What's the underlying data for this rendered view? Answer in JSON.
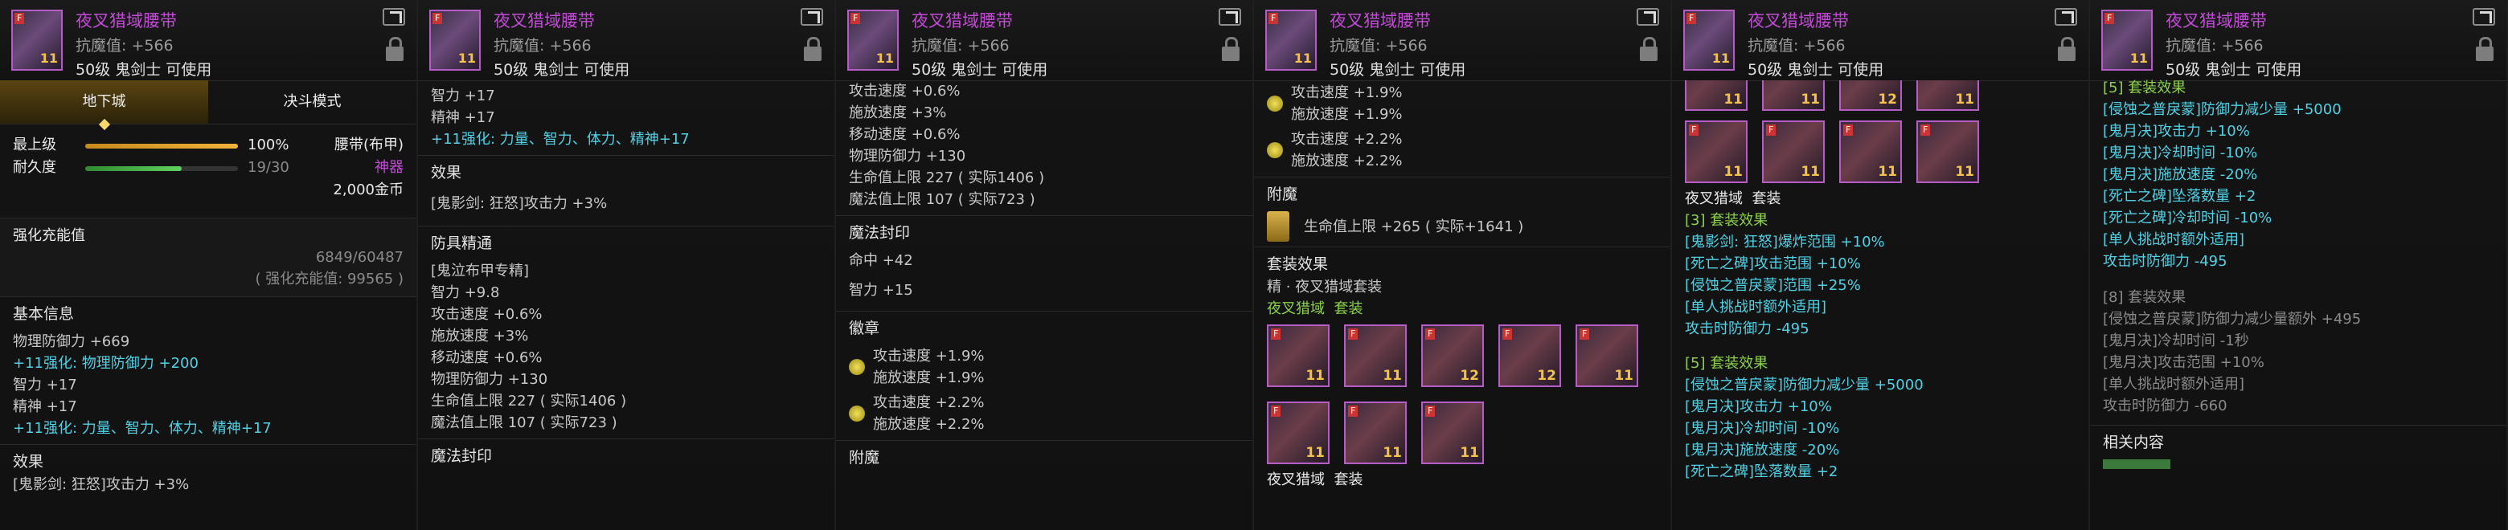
{
  "item": {
    "name": "夜叉猎域腰带",
    "anti_magic": "抗魔值: +566",
    "level_req": "50级 鬼剑士 可使用",
    "thumb_tag": "F",
    "thumb_value": "11"
  },
  "panel1": {
    "tabs": [
      "地下城",
      "决斗模式"
    ],
    "max_level_label": "最上级",
    "max_level_value": "100%",
    "durability_label": "耐久度",
    "durability_value": "19/30",
    "durability_fraction": 0.633,
    "max_level_fraction": 1.0,
    "type_label": "腰带(布甲)",
    "grade_label": "神器",
    "price": "2,000金币",
    "enhance_label": "强化充能值",
    "enhance_value": "6849/60487",
    "enhance_sub": "( 强化充能值: 99565 )",
    "basic_title": "基本信息",
    "lines": [
      "物理防御力 +669",
      "+11强化: 物理防御力 +200",
      "智力 +17",
      "精神 +17",
      "+11强化: 力量、智力、体力、精神+17"
    ],
    "effect_title": "效果",
    "effect_line": "[鬼影剑: 狂怒]攻击力 +3%"
  },
  "panel2": {
    "lines_top": [
      "智力 +17",
      "精神 +17"
    ],
    "line_cyan": "+11强化: 力量、智力、体力、精神+17",
    "effect_title": "效果",
    "effect_line": "[鬼影剑: 狂怒]攻击力 +3%",
    "armor_title": "防具精通",
    "armor_lines": [
      "[鬼泣布甲专精]",
      "智力 +9.8",
      "攻击速度 +0.6%",
      "施放速度 +3%",
      "移动速度 +0.6%",
      "物理防御力 +130",
      "生命值上限 227 ( 实际1406 )",
      "魔法值上限 107 ( 实际723 )"
    ],
    "cutoff_label": "魔法封印"
  },
  "panel3": {
    "lines_top": [
      "攻击速度 +0.6%",
      "施放速度 +3%",
      "移动速度 +0.6%",
      "物理防御力 +130",
      "生命值上限 227 ( 实际1406 )",
      "魔法值上限 107 ( 实际723 )"
    ],
    "seal_title": "魔法封印",
    "seal_lines": [
      "命中 +42",
      "智力 +15"
    ],
    "emblem_title": "徽章",
    "emblems": [
      {
        "a": "攻击速度 +1.9%",
        "b": "施放速度 +1.9%"
      },
      {
        "a": "攻击速度 +2.2%",
        "b": "施放速度 +2.2%"
      }
    ],
    "enchant_title": "附魔"
  },
  "panel4": {
    "emblems": [
      {
        "a": "攻击速度 +1.9%",
        "b": "施放速度 +1.9%"
      },
      {
        "a": "攻击速度 +2.2%",
        "b": "施放速度 +2.2%"
      }
    ],
    "enchant_title": "附魔",
    "enchant_line": "生命值上限 +265 ( 实际+1641 )",
    "set_title": "套装效果",
    "set_subtitle": "精 · 夜叉猎域套装",
    "set_name": "夜叉猎域",
    "set_word": "套装",
    "row1_nums": [
      "11",
      "11",
      "12",
      "12",
      "11"
    ],
    "row2_nums": [
      "11",
      "11",
      "11"
    ],
    "set_name2": "夜叉猎域",
    "set_word2": "套装"
  },
  "panel5": {
    "top_nums": [
      "11",
      "12",
      "11"
    ],
    "row_nums": [
      "11",
      "11",
      "11",
      "11"
    ],
    "set_name": "夜叉猎域",
    "set_word": "套装",
    "set3_title": "[3] 套装效果",
    "set3_lines": [
      "[鬼影剑: 狂怒]爆炸范围 +10%",
      "[死亡之碑]攻击范围 +10%",
      "[侵蚀之普戾蒙]范围 +25%",
      "[单人挑战时额外适用]",
      "攻击时防御力 -495"
    ],
    "set5_title": "[5] 套装效果",
    "set5_lines": [
      "[侵蚀之普戾蒙]防御力减少量 +5000",
      "[鬼月决]攻击力 +10%",
      "[鬼月决]冷却时间 -10%",
      "[鬼月决]施放速度 -20%",
      "[死亡之碑]坠落数量 +2"
    ]
  },
  "panel6": {
    "set5_title": "[5] 套装效果",
    "set5_lines": [
      "[侵蚀之普戾蒙]防御力减少量 +5000",
      "[鬼月决]攻击力 +10%",
      "[鬼月决]冷却时间 -10%",
      "[鬼月决]施放速度 -20%",
      "[死亡之碑]坠落数量 +2",
      "[死亡之碑]冷却时间 -10%",
      "[单人挑战时额外适用]",
      "攻击时防御力 -495"
    ],
    "set8_title": "[8] 套装效果",
    "set8_lines": [
      "[侵蚀之普戾蒙]防御力减少量额外 +495",
      "[鬼月决]冷却时间 -1秒",
      "[鬼月决]攻击范围 +10%",
      "[单人挑战时额外适用]",
      "攻击时防御力 -660"
    ],
    "related_title": "相关内容"
  }
}
